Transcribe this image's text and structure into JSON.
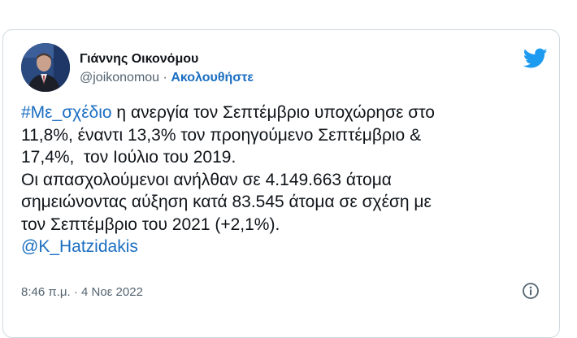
{
  "author": {
    "display_name": "Γιάννης Οικονόμου",
    "handle": "@joikonomou",
    "separator": "·",
    "follow_label": "Ακολουθήστε"
  },
  "tweet": {
    "hashtag": "#Με_σχέδιο",
    "line1_rest": " η ανεργία τον Σεπτέμβριο υποχώρησε στο",
    "line2": "11,8%, έναντι 13,3% τον προηγούμενο Σεπτέμβριο &",
    "line3": "17,4%,  τον Ιούλιο του 2019.",
    "line4": "Οι απασχολούμενοι ανήλθαν σε 4.149.663 άτομα",
    "line5": "σημειώνοντας αύξηση κατά 83.545 άτομα σε σχέση με",
    "line6": "τον Σεπτέμβριο του 2021 (+2,1%).",
    "mention": "@K_Hatzidakis"
  },
  "meta": {
    "timestamp": "8:46 π.μ. · 4 Νοε 2022"
  },
  "icons": {
    "logo": "twitter-bird-icon",
    "info": "info-icon",
    "avatar": "avatar"
  },
  "colors": {
    "link": "#1b6ec2",
    "twitter_blue": "#1d9bf0",
    "text": "#0f1419",
    "secondary": "#536471"
  }
}
